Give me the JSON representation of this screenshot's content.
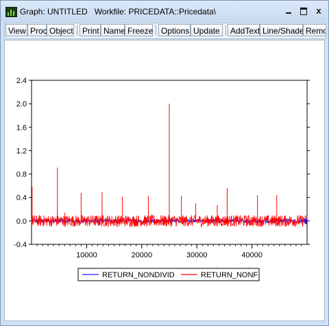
{
  "window": {
    "title": "Graph: UNTITLED   Workfile: PRICEDATA::Pricedata\\",
    "controls": {
      "minimize": "minimize",
      "maximize": "maximize",
      "close": "x"
    }
  },
  "toolbar": {
    "buttons": [
      "View",
      "Proc",
      "Object",
      "Print",
      "Name",
      "Freeze",
      "Options",
      "Update",
      "AddText",
      "Line/Shade",
      "Remo"
    ]
  },
  "colors": {
    "series_1": "#1a1aff",
    "series_2": "#ff0000",
    "window_bg": "#cfe1f5"
  },
  "chart_data": {
    "type": "line",
    "title": "",
    "xlabel": "",
    "ylabel": "",
    "xlim": [
      1,
      50000
    ],
    "ylim": [
      -0.4,
      2.4
    ],
    "x_ticks": [
      10000,
      20000,
      30000,
      40000
    ],
    "y_ticks": [
      -0.4,
      0.0,
      0.4,
      0.8,
      1.2,
      1.6,
      2.0,
      2.4
    ],
    "x_tick_labels": [
      "10000",
      "20000",
      "30000",
      "40000"
    ],
    "y_tick_labels": [
      "-0.4",
      "0.0",
      "0.4",
      "0.8",
      "1.2",
      "1.6",
      "2.0",
      "2.4"
    ],
    "grid": false,
    "legend_position": "bottom-center",
    "series": [
      {
        "name": "RETURN_NONDIVID",
        "color": "#1a1aff",
        "noise_band": [
          -0.03,
          0.03
        ],
        "spikes": []
      },
      {
        "name": "RETURN_NONF",
        "color": "#ff0000",
        "noise_band": [
          -0.1,
          0.1
        ],
        "spikes": [
          {
            "x": 100,
            "y": 0.58
          },
          {
            "x": 4700,
            "y": 0.91
          },
          {
            "x": 6000,
            "y": 0.14
          },
          {
            "x": 9000,
            "y": 0.48
          },
          {
            "x": 12800,
            "y": 0.49
          },
          {
            "x": 16500,
            "y": 0.41
          },
          {
            "x": 21200,
            "y": 0.43
          },
          {
            "x": 25000,
            "y": 2.0
          },
          {
            "x": 27200,
            "y": 0.43
          },
          {
            "x": 29800,
            "y": 0.3
          },
          {
            "x": 33700,
            "y": 0.27
          },
          {
            "x": 35500,
            "y": 0.56
          },
          {
            "x": 41000,
            "y": 0.44
          },
          {
            "x": 44500,
            "y": 0.44
          }
        ]
      }
    ]
  }
}
